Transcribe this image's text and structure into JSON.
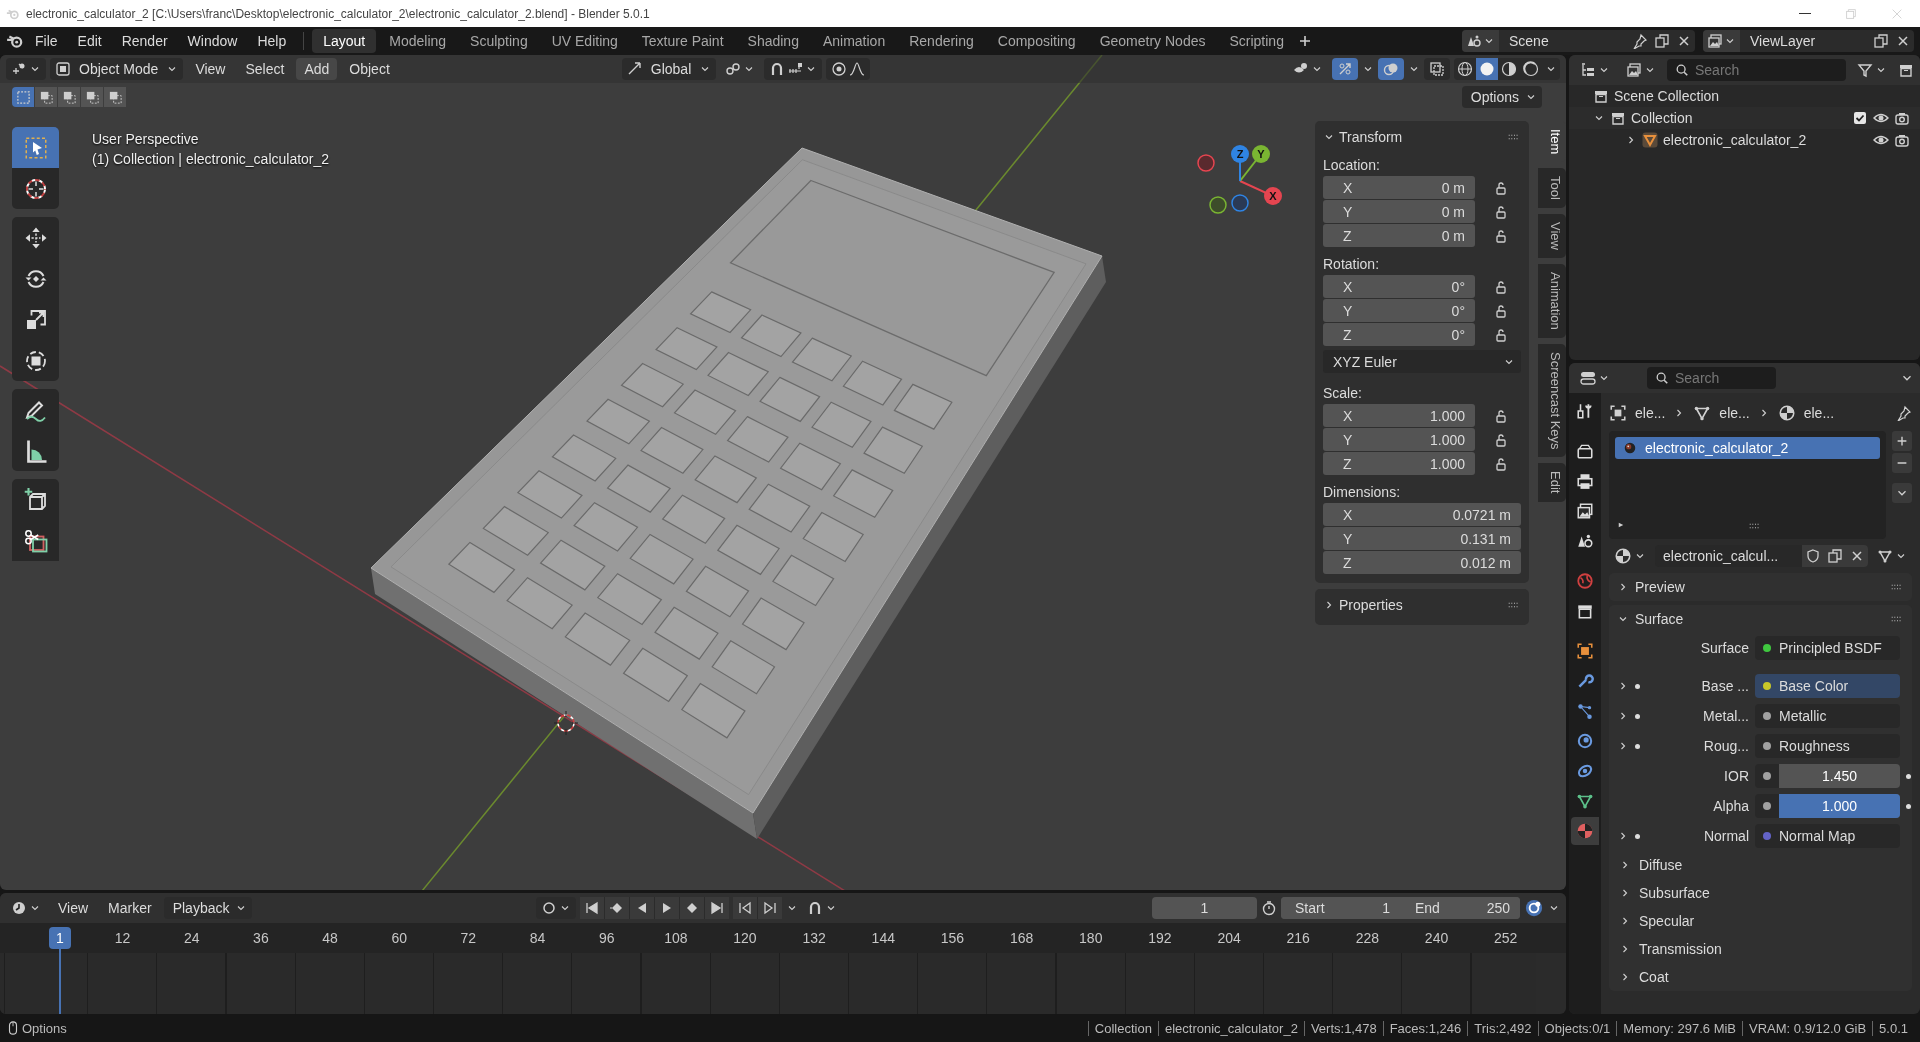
{
  "window": {
    "title": "electronic_calculator_2 [C:\\Users\\franc\\Desktop\\electronic_calculator_2\\electronic_calculator_2.blend] - Blender 5.0.1"
  },
  "menu": [
    "File",
    "Edit",
    "Render",
    "Window",
    "Help"
  ],
  "workspaces": [
    {
      "label": "Layout",
      "selected": true
    },
    {
      "label": "Modeling",
      "selected": false
    },
    {
      "label": "Sculpting",
      "selected": false
    },
    {
      "label": "UV Editing",
      "selected": false
    },
    {
      "label": "Texture Paint",
      "selected": false
    },
    {
      "label": "Shading",
      "selected": false
    },
    {
      "label": "Animation",
      "selected": false
    },
    {
      "label": "Rendering",
      "selected": false
    },
    {
      "label": "Compositing",
      "selected": false
    },
    {
      "label": "Geometry Nodes",
      "selected": false
    },
    {
      "label": "Scripting",
      "selected": false
    }
  ],
  "scene": "Scene",
  "view_layer": "ViewLayer",
  "viewport_header": {
    "mode": "Object Mode",
    "menus": [
      {
        "label": "View",
        "highlighted": false
      },
      {
        "label": "Select",
        "highlighted": false
      },
      {
        "label": "Add",
        "highlighted": true
      },
      {
        "label": "Object",
        "highlighted": false
      }
    ],
    "orientation": "Global",
    "shading": [
      {
        "kind": "wireframe",
        "selected": false
      },
      {
        "kind": "solid",
        "selected": true
      },
      {
        "kind": "material",
        "selected": false
      },
      {
        "kind": "rendered",
        "selected": false
      }
    ]
  },
  "tool_settings": {
    "select_modes": [
      {
        "selected": true
      },
      {
        "selected": false
      },
      {
        "selected": false
      },
      {
        "selected": false
      },
      {
        "selected": false
      }
    ],
    "options": "Options"
  },
  "viewport": {
    "info": [
      "User Perspective",
      "(1) Collection | electronic_calculator_2"
    ],
    "gizmo_axes": [
      "X",
      "Y",
      "Z"
    ]
  },
  "toolbar": [
    {
      "kind": "select",
      "selected": true
    },
    {
      "kind": "cursor",
      "selected": false
    },
    {
      "kind": "move",
      "selected": false
    },
    {
      "kind": "rotate",
      "selected": false
    },
    {
      "kind": "scale",
      "selected": false
    },
    {
      "kind": "transform",
      "selected": false
    },
    {
      "kind": "annotate",
      "selected": false
    },
    {
      "kind": "measure",
      "selected": false
    },
    {
      "kind": "add-cube",
      "selected": false
    },
    {
      "kind": "cut",
      "selected": false
    }
  ],
  "sidebar": {
    "tabs": [
      {
        "label": "Item",
        "selected": true
      },
      {
        "label": "Tool",
        "selected": false
      },
      {
        "label": "View",
        "selected": false
      },
      {
        "label": "Animation",
        "selected": false
      },
      {
        "label": "Screencast Keys",
        "selected": false
      },
      {
        "label": "Edit",
        "selected": false
      }
    ],
    "panel": {
      "title": "Transform",
      "expanded": true,
      "location": {
        "label": "Location:",
        "rows": [
          {
            "axis": "X",
            "value": "0 m",
            "locked": false
          },
          {
            "axis": "Y",
            "value": "0 m",
            "locked": false
          },
          {
            "axis": "Z",
            "value": "0 m",
            "locked": false
          }
        ]
      },
      "rotation": {
        "label": "Rotation:",
        "rows": [
          {
            "axis": "X",
            "value": "0°",
            "locked": false
          },
          {
            "axis": "Y",
            "value": "0°",
            "locked": false
          },
          {
            "axis": "Z",
            "value": "0°",
            "locked": false
          }
        ]
      },
      "rotation_mode": "XYZ Euler",
      "scale": {
        "label": "Scale:",
        "rows": [
          {
            "axis": "X",
            "value": "1.000",
            "locked": false
          },
          {
            "axis": "Y",
            "value": "1.000",
            "locked": false
          },
          {
            "axis": "Z",
            "value": "1.000",
            "locked": false
          }
        ]
      },
      "dimensions": {
        "label": "Dimensions:",
        "rows": [
          {
            "axis": "X",
            "value": "0.0721 m"
          },
          {
            "axis": "Y",
            "value": "0.131 m"
          },
          {
            "axis": "Z",
            "value": "0.012 m"
          }
        ]
      }
    },
    "collapsed": [
      {
        "title": "Properties",
        "expanded": false
      }
    ]
  },
  "outliner": {
    "search": {
      "placeholder": "Search"
    },
    "root": "Scene Collection",
    "items": [
      {
        "label": "Collection",
        "kind": "collection",
        "expanded": true,
        "checked": true,
        "children": [
          {
            "label": "electronic_calculator_2",
            "kind": "mesh",
            "expanded": false
          }
        ]
      }
    ]
  },
  "properties": {
    "search": {
      "placeholder": "Search"
    },
    "tabs": [
      {
        "kind": "tool",
        "selected": false
      },
      {
        "kind": "render",
        "selected": false
      },
      {
        "kind": "output",
        "selected": false
      },
      {
        "kind": "view-layer",
        "selected": false
      },
      {
        "kind": "scene",
        "selected": false
      },
      {
        "kind": "world",
        "selected": false
      },
      {
        "kind": "collection",
        "selected": false
      },
      {
        "kind": "object",
        "selected": false
      },
      {
        "kind": "modifier",
        "selected": false
      },
      {
        "kind": "particles",
        "selected": false
      },
      {
        "kind": "physics",
        "selected": false
      },
      {
        "kind": "constraints",
        "selected": false
      },
      {
        "kind": "data",
        "selected": false
      },
      {
        "kind": "material",
        "selected": true
      }
    ],
    "breadcrumb": [
      "ele...",
      "ele...",
      "ele..."
    ],
    "slots": [
      {
        "label": "electronic_calculator_2",
        "selected": true
      }
    ],
    "material": "electronic_calcul...",
    "panels": [
      {
        "title": "Preview",
        "expanded": false
      },
      {
        "title": "Surface",
        "expanded": true
      }
    ],
    "surface": {
      "label": "Surface",
      "value": "Principled BSDF"
    },
    "inputs": [
      {
        "kind": "link",
        "label": "Base ...",
        "value": "Base Color",
        "color": "#c7c729",
        "highlighted": true
      },
      {
        "kind": "link",
        "label": "Metal...",
        "value": "Metallic",
        "color": "#a1a1a1",
        "highlighted": false
      },
      {
        "kind": "link",
        "label": "Roug...",
        "value": "Roughness",
        "color": "#a1a1a1",
        "highlighted": false
      },
      {
        "kind": "number",
        "label": "IOR",
        "value": "1.450",
        "color": "#a1a1a1"
      },
      {
        "kind": "factor",
        "label": "Alpha",
        "value": "1.000",
        "color": "#a1a1a1",
        "level": 1
      },
      {
        "kind": "link",
        "label": "Normal",
        "value": "Normal Map",
        "color": "#6363c7",
        "highlighted": false
      }
    ],
    "subpanels": [
      {
        "title": "Diffuse",
        "expanded": false
      },
      {
        "title": "Subsurface",
        "expanded": false
      },
      {
        "title": "Specular",
        "expanded": false
      },
      {
        "title": "Transmission",
        "expanded": false
      },
      {
        "title": "Coat",
        "expanded": false
      }
    ]
  },
  "timeline": {
    "menus": [
      "View",
      "Marker",
      "Playback"
    ],
    "frame": "1",
    "start": {
      "label": "Start",
      "value": "1"
    },
    "end": {
      "label": "End",
      "value": "250"
    },
    "playhead": "1",
    "ruler": [
      "12",
      "24",
      "36",
      "48",
      "60",
      "72",
      "84",
      "96",
      "108",
      "120",
      "132",
      "144",
      "156",
      "168",
      "180",
      "192",
      "204",
      "216",
      "228",
      "240",
      "252"
    ]
  },
  "status_bar": {
    "left": "Options",
    "stats": [
      "Collection",
      "electronic_calculator_2",
      "Verts:1,478",
      "Faces:1,246",
      "Tris:2,492",
      "Objects:0/1",
      "Memory: 297.6 MiB",
      "VRAM: 0.9/12.0 GiB",
      "5.0.1"
    ]
  }
}
